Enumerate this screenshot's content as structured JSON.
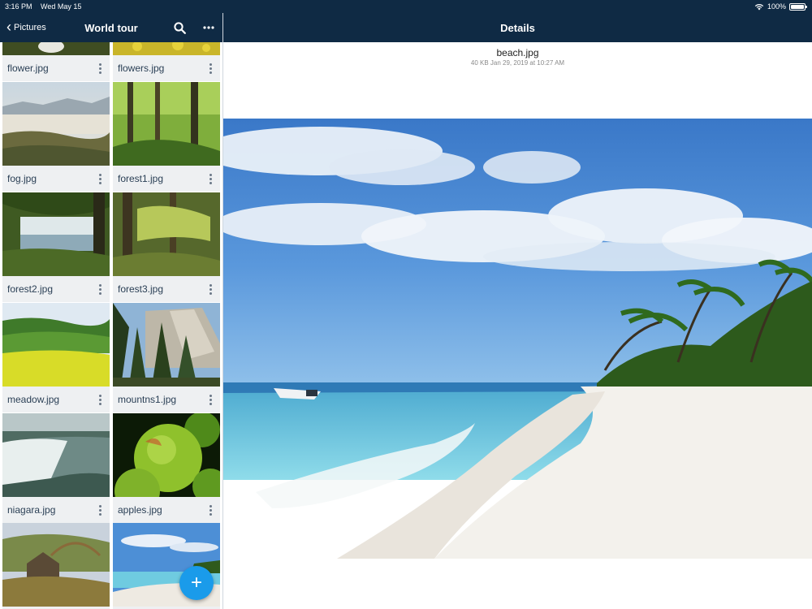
{
  "status": {
    "time": "3:16 PM",
    "date": "Wed May 15",
    "battery": "100%"
  },
  "left_header": {
    "back_label": "Pictures",
    "title": "World tour"
  },
  "right_header": {
    "title": "Details"
  },
  "details": {
    "filename": "beach.jpg",
    "meta": "40 KB  Jan 29, 2019 at 10:27 AM"
  },
  "files": [
    {
      "name": "flower.jpg"
    },
    {
      "name": "flowers.jpg"
    },
    {
      "name": "fog.jpg"
    },
    {
      "name": "forest1.jpg"
    },
    {
      "name": "forest2.jpg"
    },
    {
      "name": "forest3.jpg"
    },
    {
      "name": "meadow.jpg"
    },
    {
      "name": "mountns1.jpg"
    },
    {
      "name": "niagara.jpg"
    },
    {
      "name": "apples.jpg"
    },
    {
      "name": ""
    },
    {
      "name": ""
    }
  ],
  "colors": {
    "header_bg": "#0f2a44",
    "fab": "#1a9bea",
    "caption_bg": "#eef0f2"
  }
}
